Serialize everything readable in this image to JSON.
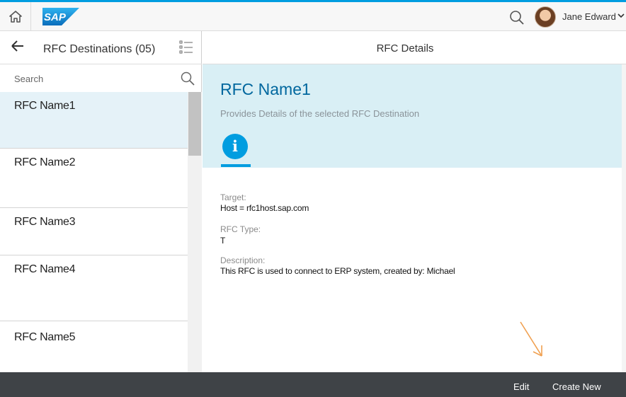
{
  "app": {
    "logo_text": "SAP",
    "user_name": "Jane Edward",
    "user_chevron": "❯"
  },
  "master": {
    "title": "RFC Destinations (05)",
    "search_placeholder": "Search",
    "items": [
      {
        "label": "RFC Name1",
        "selected": true
      },
      {
        "label": "RFC Name2",
        "selected": false
      },
      {
        "label": "RFC Name3",
        "selected": false
      },
      {
        "label": "RFC Name4",
        "selected": false
      },
      {
        "label": "RFC Name5",
        "selected": false
      }
    ]
  },
  "detail": {
    "page_title": "RFC Details",
    "object_title": "RFC Name1",
    "object_subtitle": "Provides Details of the selected RFC Destination",
    "info_tab_glyph": "i",
    "fields": [
      {
        "label": "Target:",
        "value": "Host = rfc1host.sap.com"
      },
      {
        "label": "RFC Type:",
        "value": "T"
      },
      {
        "label": "Description:",
        "value": "This RFC is used to connect to ERP system, created by: Michael"
      }
    ]
  },
  "footer": {
    "edit_label": "Edit",
    "create_label": "Create New"
  },
  "colors": {
    "accent": "#009de0",
    "object_header_bg": "#d9eff5",
    "footer_bg": "#3f4347",
    "selected_row": "#e5f2f8",
    "annotation_arrow": "#f0a050"
  },
  "icons": [
    "home-icon",
    "sap-logo",
    "search-icon",
    "avatar",
    "chevron-down-icon",
    "back-arrow-icon",
    "list-mode-icon",
    "info-icon"
  ]
}
